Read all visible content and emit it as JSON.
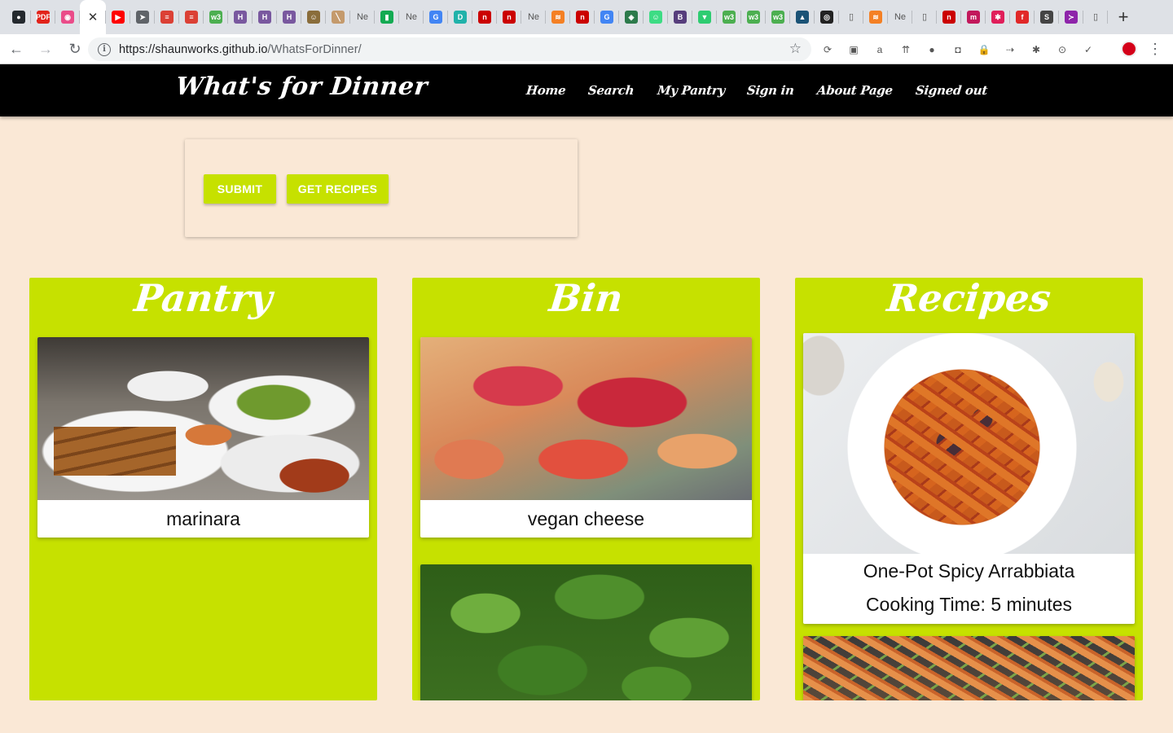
{
  "browser": {
    "tabs": [
      {
        "icon": "github-icon",
        "glyph": "●",
        "color": "#24292e"
      },
      {
        "icon": "pdf-icon",
        "glyph": "PDF",
        "color": "#e2231a"
      },
      {
        "icon": "dribbble-icon",
        "glyph": "◉",
        "color": "#ea4c89"
      },
      {
        "icon": "close-icon",
        "glyph": "✕",
        "color": "#333333",
        "active": true
      },
      {
        "icon": "youtube-icon",
        "glyph": "▶",
        "color": "#ff0000"
      },
      {
        "icon": "telegram-icon",
        "glyph": "➤",
        "color": "#5f6368"
      },
      {
        "icon": "todoist-icon",
        "glyph": "≡",
        "color": "#db4035"
      },
      {
        "icon": "todoist-icon",
        "glyph": "≡",
        "color": "#db4035"
      },
      {
        "icon": "w3schools-icon",
        "glyph": "w3",
        "color": "#4caf50"
      },
      {
        "icon": "heroku-icon",
        "glyph": "H",
        "color": "#79589f"
      },
      {
        "icon": "heroku-icon",
        "glyph": "H",
        "color": "#79589f"
      },
      {
        "icon": "heroku-icon",
        "glyph": "H",
        "color": "#79589f"
      },
      {
        "icon": "avatar-icon",
        "glyph": "☺",
        "color": "#8a6d3b"
      },
      {
        "icon": "page-icon",
        "glyph": "╲",
        "color": "#c49a6c"
      },
      {
        "icon": "text-icon",
        "glyph": "Ne",
        "text": true
      },
      {
        "icon": "mongodb-icon",
        "glyph": "▮",
        "color": "#13aa52"
      },
      {
        "icon": "text-icon",
        "glyph": "Ne",
        "text": true
      },
      {
        "icon": "google-icon",
        "glyph": "G",
        "color": "#4285f4"
      },
      {
        "icon": "docs-icon",
        "glyph": "D",
        "color": "#20b2aa"
      },
      {
        "icon": "npm-icon",
        "glyph": "n",
        "color": "#cb0000"
      },
      {
        "icon": "npm-icon",
        "glyph": "n",
        "color": "#cb0000"
      },
      {
        "icon": "text-icon",
        "glyph": "Ne",
        "text": true
      },
      {
        "icon": "stackoverflow-icon",
        "glyph": "≋",
        "color": "#f48024"
      },
      {
        "icon": "npm-icon",
        "glyph": "n",
        "color": "#cb0000"
      },
      {
        "icon": "google-icon",
        "glyph": "G",
        "color": "#4285f4"
      },
      {
        "icon": "diamond-icon",
        "glyph": "◈",
        "color": "#2c7a4b"
      },
      {
        "icon": "chat-icon",
        "glyph": "☺",
        "color": "#3ddc84"
      },
      {
        "icon": "bootstrap-icon",
        "glyph": "B",
        "color": "#563d7c"
      },
      {
        "icon": "shield-icon",
        "glyph": "▼",
        "color": "#2ecc71"
      },
      {
        "icon": "w3schools-icon",
        "glyph": "w3",
        "color": "#4caf50"
      },
      {
        "icon": "w3schools-icon",
        "glyph": "w3",
        "color": "#4caf50"
      },
      {
        "icon": "w3schools-icon",
        "glyph": "w3",
        "color": "#4caf50"
      },
      {
        "icon": "graduation-icon",
        "glyph": "▲",
        "color": "#1a5276"
      },
      {
        "icon": "circle-icon",
        "glyph": "◎",
        "color": "#222222"
      },
      {
        "icon": "blank-page-icon",
        "glyph": "▯",
        "text": true
      },
      {
        "icon": "stackoverflow-icon",
        "glyph": "≋",
        "color": "#f48024"
      },
      {
        "icon": "text-icon",
        "glyph": "Ne",
        "text": true
      },
      {
        "icon": "blank-page-icon",
        "glyph": "▯",
        "text": true
      },
      {
        "icon": "npm-icon",
        "glyph": "n",
        "color": "#cb0000"
      },
      {
        "icon": "medium-icon",
        "glyph": "m",
        "color": "#c2185b"
      },
      {
        "icon": "slack-icon",
        "glyph": "✱",
        "color": "#e01e5a"
      },
      {
        "icon": "flipboard-icon",
        "glyph": "f",
        "color": "#e12828"
      },
      {
        "icon": "s-circle-icon",
        "glyph": "S",
        "color": "#444444"
      },
      {
        "icon": "arrow-icon",
        "glyph": "≻",
        "color": "#8e24aa"
      },
      {
        "icon": "blank-page-icon",
        "glyph": "▯",
        "text": true
      }
    ],
    "new_tab": "+",
    "url_host": "https://shaunworks.github.io",
    "url_path": "/WhatsForDinner/",
    "extensions": [
      "⟳",
      "▣",
      "a",
      "⇈",
      "●",
      "◘",
      "🔒",
      "⇢",
      "✱",
      "⊙",
      "✓"
    ]
  },
  "site": {
    "brand": "What's for Dinner",
    "nav": [
      "Home",
      "Search",
      "My Pantry",
      "Sign in",
      "About Page",
      "Signed out"
    ],
    "buttons": {
      "submit": "SUBMIT",
      "get_recipes": "GET RECIPES"
    },
    "columns": {
      "pantry": {
        "title": "Pantry",
        "items": [
          "marinara"
        ]
      },
      "bin": {
        "title": "Bin",
        "items": [
          "vegan cheese"
        ]
      },
      "recipes": {
        "title": "Recipes",
        "items": [
          {
            "name": "One-Pot Spicy Arrabbiata",
            "time": "Cooking Time: 5 minutes"
          }
        ]
      }
    },
    "colors": {
      "accent": "#c6e100",
      "background": "#fae8d6",
      "navbar": "#000000"
    }
  }
}
